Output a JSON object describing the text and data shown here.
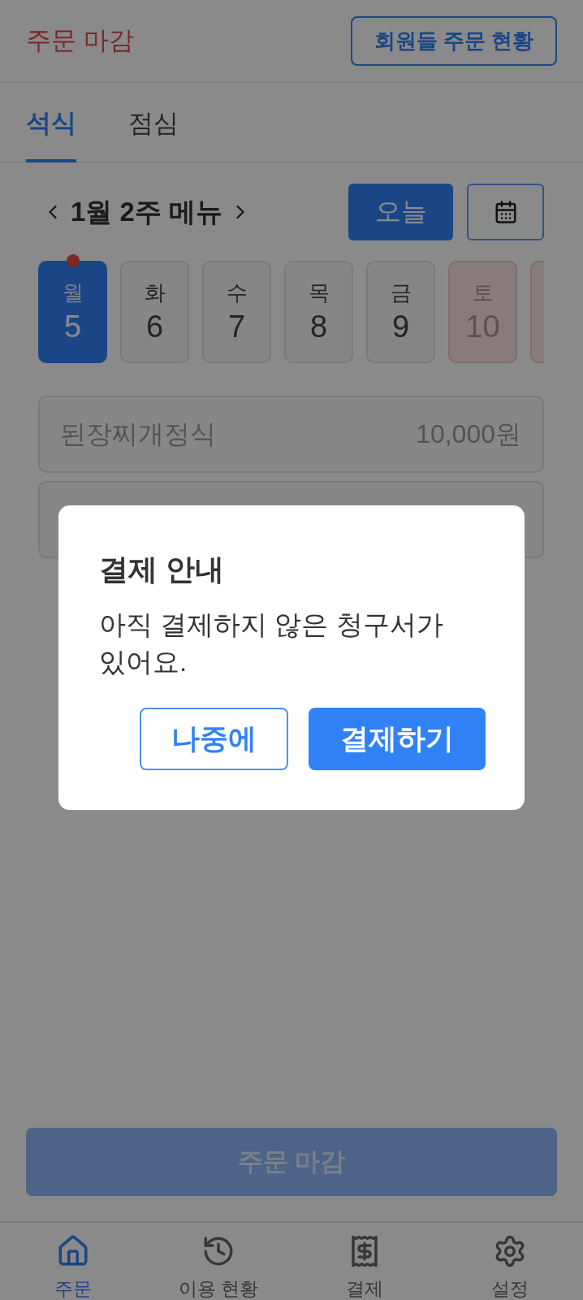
{
  "header": {
    "title": "주문 마감",
    "action_button": "회원들 주문 현황"
  },
  "tabs": [
    {
      "label": "석식",
      "selected": true
    },
    {
      "label": "점심",
      "selected": false
    }
  ],
  "week_nav": {
    "title": "1월 2주 메뉴",
    "today_button": "오늘"
  },
  "days": [
    {
      "kind": "full",
      "weekday": "월",
      "date": "5",
      "selected": true,
      "weekend": false,
      "dot": true
    },
    {
      "kind": "full",
      "weekday": "화",
      "date": "6",
      "selected": false,
      "weekend": false,
      "dot": false
    },
    {
      "kind": "full",
      "weekday": "수",
      "date": "7",
      "selected": false,
      "weekend": false,
      "dot": false
    },
    {
      "kind": "full",
      "weekday": "목",
      "date": "8",
      "selected": false,
      "weekend": false,
      "dot": false
    },
    {
      "kind": "full",
      "weekday": "금",
      "date": "9",
      "selected": false,
      "weekend": false,
      "dot": false
    },
    {
      "kind": "full",
      "weekday": "토",
      "date": "10",
      "selected": false,
      "weekend": true,
      "dot": false
    },
    {
      "kind": "clipped",
      "selected": false,
      "weekend": true
    }
  ],
  "menu_items": [
    {
      "kind": "full",
      "name": "된장찌개정식",
      "price": "10,000원"
    },
    {
      "kind": "covered"
    }
  ],
  "dialog": {
    "title": "결제 안내",
    "message": "아직 결제하지 않은 청구서가 있어요.",
    "buttons": [
      {
        "label": "나중에",
        "kind": "secondary"
      },
      {
        "label": "결제하기",
        "kind": "primary"
      }
    ]
  },
  "submit_button": {
    "label": "주문 마감",
    "disabled": true
  },
  "bottom_nav": [
    {
      "label": "주문",
      "selected": true
    },
    {
      "label": "이용 현황",
      "selected": false
    },
    {
      "label": "결제",
      "selected": false
    },
    {
      "label": "설정",
      "selected": false
    }
  ]
}
